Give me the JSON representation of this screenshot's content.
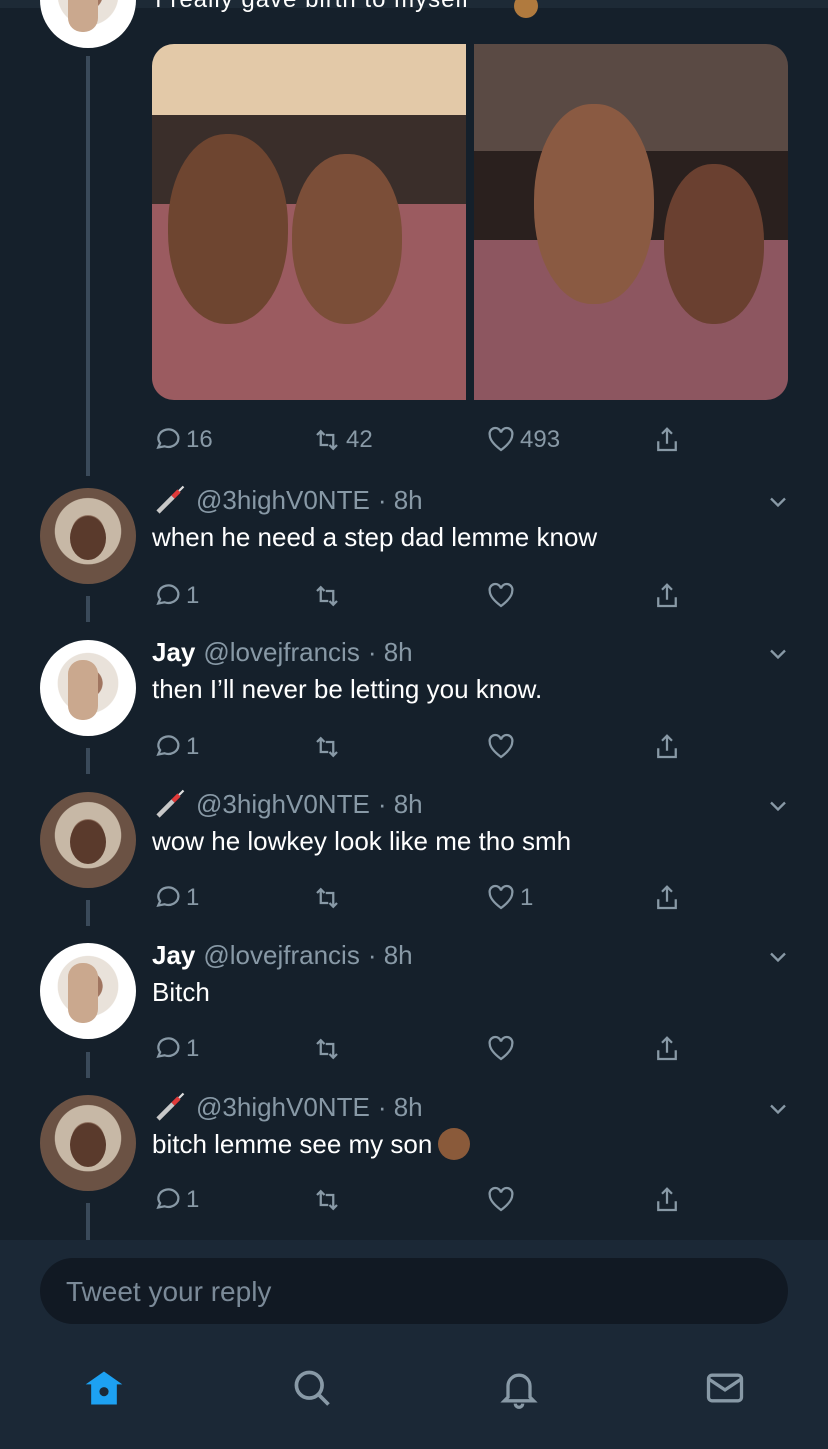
{
  "tweet": {
    "text_partial": "I really gave birth to myself",
    "stats": {
      "replies": "16",
      "retweets": "42",
      "likes": "493"
    }
  },
  "replies": [
    {
      "name": "",
      "handle": "@3highV0NTE",
      "time": "· 8h",
      "text": "when he need a step dad lemme know",
      "reply_count": "1",
      "like_count": ""
    },
    {
      "name": "Jay",
      "handle": "@lovejfrancis",
      "time": "· 8h",
      "text": "then I’ll never be letting you know.",
      "reply_count": "1",
      "like_count": ""
    },
    {
      "name": "",
      "handle": "@3highV0NTE",
      "time": "· 8h",
      "text": "wow he lowkey look like me tho smh",
      "reply_count": "1",
      "like_count": "1"
    },
    {
      "name": "Jay",
      "handle": "@lovejfrancis",
      "time": "· 8h",
      "text": "Bitch",
      "reply_count": "1",
      "like_count": ""
    },
    {
      "name": "",
      "handle": "@3highV0NTE",
      "time": "· 8h",
      "text": "bitch lemme see my son",
      "reply_count": "1",
      "like_count": ""
    }
  ],
  "composer": {
    "placeholder": "Tweet your reply"
  },
  "nav": {
    "active": "home",
    "items": [
      "home-icon",
      "search-icon",
      "notifications-icon",
      "messages-icon"
    ]
  },
  "colors": {
    "background": "#15202b",
    "accent": "#1da1f2",
    "muted": "#8899a6"
  }
}
